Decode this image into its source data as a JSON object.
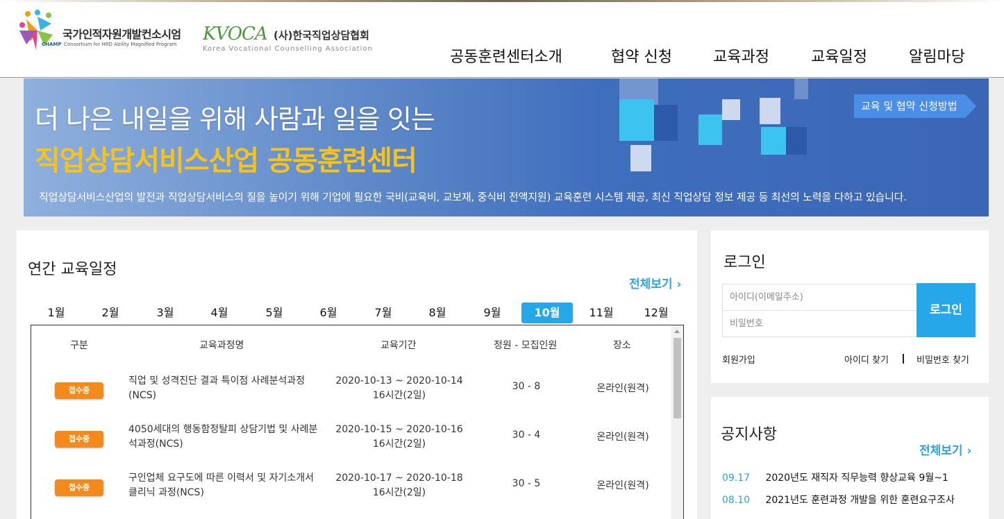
{
  "header": {
    "logo1": {
      "title": "국가인적자원개발컨소시엄",
      "champ": "CHAMP",
      "subtitle": "Consortium for HRD Ability Magnified Program"
    },
    "logo2": {
      "mark": "KVOCA",
      "name": "(사)한국직업상담협회",
      "subtitle": "Korea Vocational Counselling Association"
    },
    "nav": [
      "공동훈련센터소개",
      "협약 신청",
      "교육과정",
      "교육일정",
      "알림마당"
    ]
  },
  "banner": {
    "headline1": "더 나은 내일을 위해 사람과 일을 잇는",
    "headline2": "직업상담서비스산업 공동훈련센터",
    "description": "직업상담서비스산업의 발전과 직업상담서비스의 질을 높이기 위해 기업에 필요한 국비(교육비, 교보재, 중식비 전액지원) 교육훈련 시스템 제공, 최신 직업상담 정보 제공 등 최선의 노력을 다하고 있습니다.",
    "cta_label": "교육 및 협약 신청방법"
  },
  "schedule": {
    "title": "연간 교육일정",
    "more_label": "전체보기",
    "months": [
      "1월",
      "2월",
      "3월",
      "4월",
      "5월",
      "6월",
      "7월",
      "8월",
      "9월",
      "10월",
      "11월",
      "12월"
    ],
    "active_month": "10월",
    "columns": [
      "구분",
      "교육과정명",
      "교육기간",
      "정원 - 모집인원",
      "장소"
    ],
    "rows": [
      {
        "status": "접수중",
        "name": "직업 및 성격진단 결과 특이점 사례분석과정(NCS)",
        "period": "2020-10-13 ~ 2020-10-14",
        "hours": "16시간(2일)",
        "capacity": "30 - 8",
        "place": "온라인(원격)"
      },
      {
        "status": "접수중",
        "name": "4050세대의 행동함정탈피 상담기법 및 사례분석과정(NCS)",
        "period": "2020-10-15 ~ 2020-10-16",
        "hours": "16시간(2일)",
        "capacity": "30 - 4",
        "place": "온라인(원격)"
      },
      {
        "status": "접수중",
        "name": "구인업체 요구도에 따른 이력서 및 자기소개서 클리닉 과정(NCS)",
        "period": "2020-10-17 ~ 2020-10-18",
        "hours": "16시간(2일)",
        "capacity": "30 - 5",
        "place": "온라인(원격)"
      }
    ]
  },
  "login": {
    "title": "로그인",
    "id_placeholder": "아이디(이메일주소)",
    "pw_placeholder": "비밀번호",
    "button_label": "로그인",
    "signup_label": "회원가입",
    "find_id_label": "아이디 찾기",
    "find_pw_label": "비밀번호 찾기"
  },
  "notice": {
    "title": "공지사항",
    "more_label": "전체보기",
    "items": [
      {
        "date": "09.17",
        "text": "2020년도 재직자 직무능력 향상교육 9월~1"
      },
      {
        "date": "08.10",
        "text": "2021년도 훈련과정 개발을 위한 훈련요구조사"
      }
    ]
  },
  "colors": {
    "accent": "#25a7ea",
    "badge": "#f48a1b",
    "banner_yellow": "#f6c21c"
  }
}
